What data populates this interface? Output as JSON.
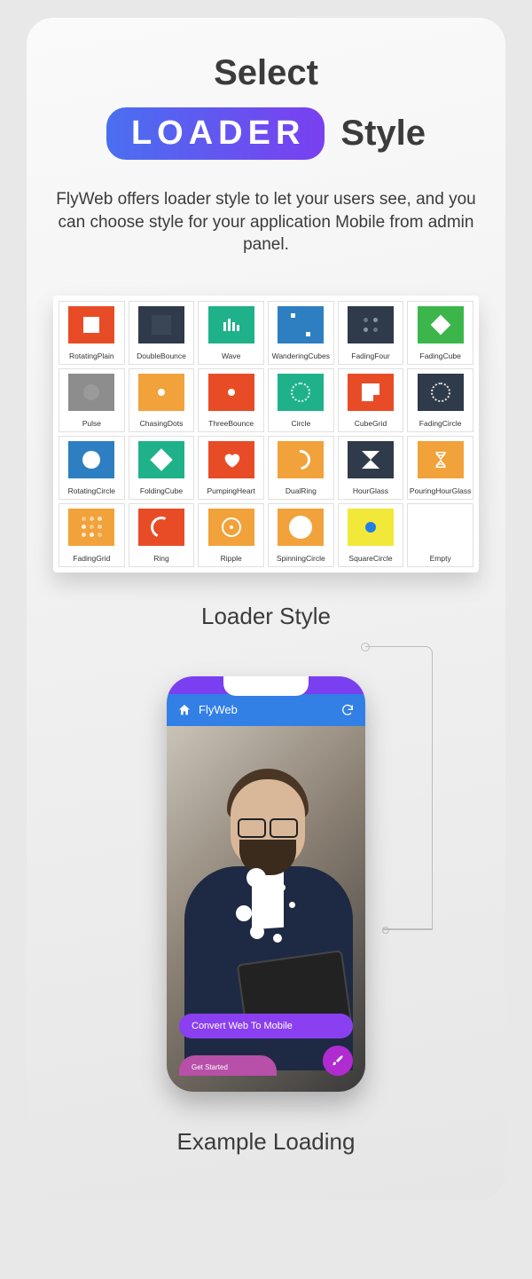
{
  "heading": {
    "select": "Select",
    "pill": "LOADER",
    "style": "Style"
  },
  "description": "FlyWeb offers loader style to let your users see, and you can choose style for your application Mobile from admin panel.",
  "section_loader_style": "Loader Style",
  "section_example_loading": "Example Loading",
  "loaders": [
    {
      "label": "RotatingPlain",
      "bg": "#e84c27",
      "icon": "square-white"
    },
    {
      "label": "DoubleBounce",
      "bg": "#2f3a4a",
      "icon": "square-dark"
    },
    {
      "label": "Wave",
      "bg": "#1fb28a",
      "icon": "wave"
    },
    {
      "label": "WanderingCubes",
      "bg": "#2d7fc1",
      "icon": "two-dots"
    },
    {
      "label": "FadingFour",
      "bg": "#2f3a4a",
      "icon": "four-dots-dark"
    },
    {
      "label": "FadingCube",
      "bg": "#3cb64a",
      "icon": "diamond"
    },
    {
      "label": "Pulse",
      "bg": "#8d8d8d",
      "icon": "circle-gray"
    },
    {
      "label": "ChasingDots",
      "bg": "#f2a23a",
      "icon": "dot"
    },
    {
      "label": "ThreeBounce",
      "bg": "#e84c27",
      "icon": "dot"
    },
    {
      "label": "Circle",
      "bg": "#1fb28a",
      "icon": "dot-ring"
    },
    {
      "label": "CubeGrid",
      "bg": "#e84c27",
      "icon": "grid"
    },
    {
      "label": "FadingCircle",
      "bg": "#2f3a4a",
      "icon": "dot-ring"
    },
    {
      "label": "RotatingCircle",
      "bg": "#2d7fc1",
      "icon": "circle-white"
    },
    {
      "label": "FoldingCube",
      "bg": "#1fb28a",
      "icon": "diamond-white"
    },
    {
      "label": "PumpingHeart",
      "bg": "#e84c27",
      "icon": "heart"
    },
    {
      "label": "DualRing",
      "bg": "#f2a23a",
      "icon": "dual-ring"
    },
    {
      "label": "HourGlass",
      "bg": "#2f3a4a",
      "icon": "hourglass"
    },
    {
      "label": "PouringHourGlass",
      "bg": "#f2a23a",
      "icon": "hourglass-o"
    },
    {
      "label": "FadingGrid",
      "bg": "#f2a23a",
      "icon": "nine-dots"
    },
    {
      "label": "Ring",
      "bg": "#e84c27",
      "icon": "ring"
    },
    {
      "label": "Ripple",
      "bg": "#f2a23a",
      "icon": "ripple"
    },
    {
      "label": "SpinningCircle",
      "bg": "#f2a23a",
      "icon": "circle-white-big"
    },
    {
      "label": "SquareCircle",
      "bg": "#f2e83a",
      "icon": "blue-dot"
    },
    {
      "label": "Empty",
      "bg": "#ffffff",
      "icon": "none"
    }
  ],
  "phone": {
    "app_title": "FlyWeb",
    "convert_label": "Convert Web To Mobile",
    "get_started": "Get Started"
  }
}
